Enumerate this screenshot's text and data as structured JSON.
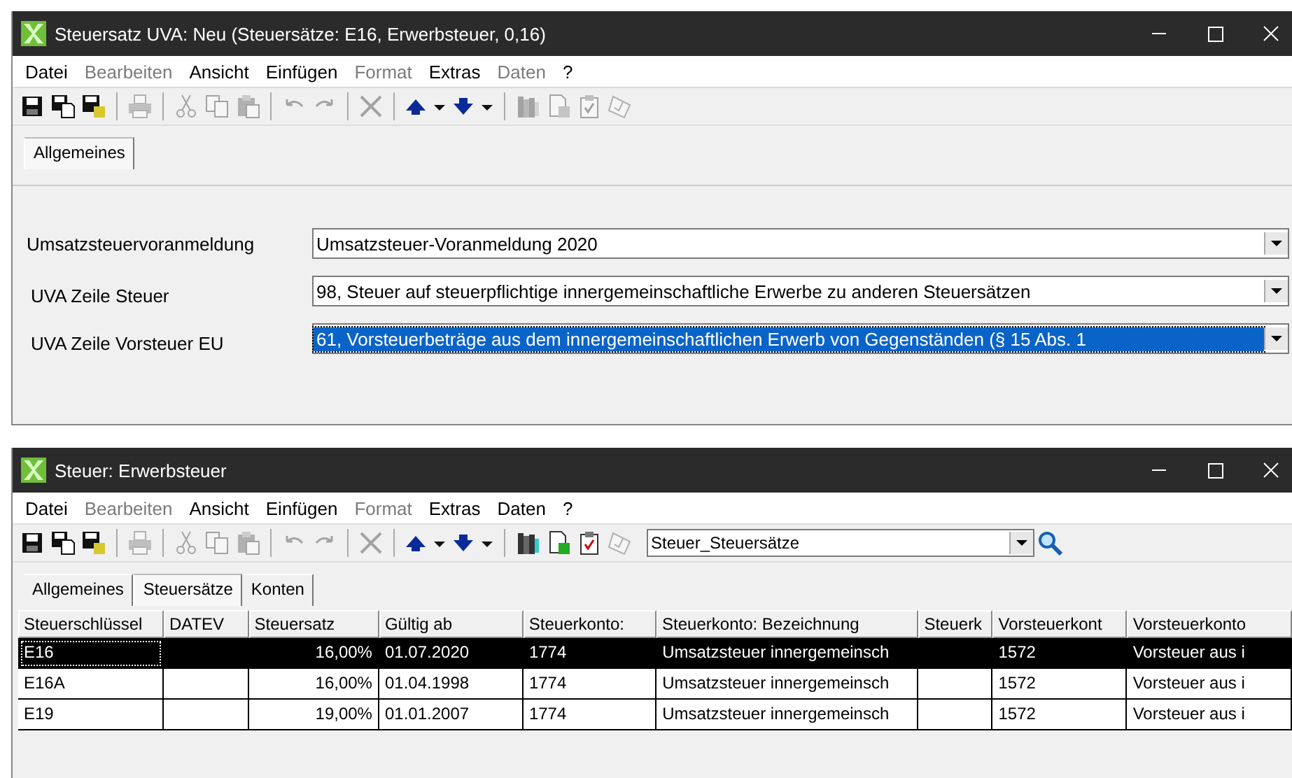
{
  "windows": [
    {
      "title": "Steuersatz UVA: Neu (Steuersätze: E16, Erwerbsteuer, 0,16)",
      "menu": [
        {
          "label": "Datei",
          "disabled": false
        },
        {
          "label": "Bearbeiten",
          "disabled": true
        },
        {
          "label": "Ansicht",
          "disabled": false
        },
        {
          "label": "Einfügen",
          "disabled": false
        },
        {
          "label": "Format",
          "disabled": true
        },
        {
          "label": "Extras",
          "disabled": false
        },
        {
          "label": "Daten",
          "disabled": true
        },
        {
          "label": "?",
          "disabled": false
        }
      ],
      "toolbar": [
        [
          {
            "kind": "save",
            "disabled": false
          },
          {
            "kind": "save-copy",
            "disabled": false
          },
          {
            "kind": "save-all",
            "disabled": false
          }
        ],
        [
          {
            "kind": "print",
            "disabled": true
          }
        ],
        [
          {
            "kind": "cut",
            "disabled": true
          },
          {
            "kind": "copy",
            "disabled": true
          },
          {
            "kind": "paste",
            "disabled": true
          }
        ],
        [
          {
            "kind": "undo",
            "disabled": true
          },
          {
            "kind": "redo",
            "disabled": true
          }
        ],
        [
          {
            "kind": "delete",
            "disabled": true
          }
        ],
        [
          {
            "kind": "up",
            "disabled": false
          },
          {
            "kind": "down",
            "disabled": false
          }
        ],
        [
          {
            "kind": "binder",
            "disabled": true
          },
          {
            "kind": "doc-add",
            "disabled": true
          },
          {
            "kind": "checklist",
            "disabled": true
          },
          {
            "kind": "stamp",
            "disabled": true
          }
        ]
      ],
      "tabs": [
        {
          "label": "Allgemeines",
          "selected": true
        }
      ],
      "form": [
        {
          "label": "Umsatzsteuervoranmeldung",
          "value": "Umsatzsteuer-Voranmeldung 2020",
          "selected": false
        },
        {
          "label": "UVA Zeile Steuer",
          "value": "98, Steuer auf steuerpflichtige innergemeinschaftliche Erwerbe zu anderen Steuersätzen",
          "selected": false
        },
        {
          "label": "UVA Zeile Vorsteuer EU",
          "value": "61, Vorsteuerbeträge aus dem innergemeinschaftlichen Erwerb von Gegenständen (§ 15 Abs. 1",
          "selected": true
        }
      ]
    },
    {
      "title": "Steuer: Erwerbsteuer",
      "menu": [
        {
          "label": "Datei",
          "disabled": false
        },
        {
          "label": "Bearbeiten",
          "disabled": true
        },
        {
          "label": "Ansicht",
          "disabled": false
        },
        {
          "label": "Einfügen",
          "disabled": false
        },
        {
          "label": "Format",
          "disabled": true
        },
        {
          "label": "Extras",
          "disabled": false
        },
        {
          "label": "Daten",
          "disabled": false
        },
        {
          "label": "?",
          "disabled": false
        }
      ],
      "toolbar": [
        [
          {
            "kind": "save",
            "disabled": false
          },
          {
            "kind": "save-copy",
            "disabled": false
          },
          {
            "kind": "save-all",
            "disabled": false
          }
        ],
        [
          {
            "kind": "print",
            "disabled": true
          }
        ],
        [
          {
            "kind": "cut",
            "disabled": true
          },
          {
            "kind": "copy",
            "disabled": true
          },
          {
            "kind": "paste",
            "disabled": true
          }
        ],
        [
          {
            "kind": "undo",
            "disabled": true
          },
          {
            "kind": "redo",
            "disabled": true
          }
        ],
        [
          {
            "kind": "delete",
            "disabled": true
          }
        ],
        [
          {
            "kind": "up",
            "disabled": false
          },
          {
            "kind": "down",
            "disabled": false
          }
        ],
        [
          {
            "kind": "binder",
            "disabled": false
          },
          {
            "kind": "doc-add",
            "disabled": false
          },
          {
            "kind": "checklist",
            "disabled": false
          },
          {
            "kind": "stamp",
            "disabled": true
          }
        ]
      ],
      "view_select": {
        "value": "Steuer_Steuersätze"
      },
      "tabs": [
        {
          "label": "Allgemeines",
          "selected": false
        },
        {
          "label": "Steuersätze",
          "selected": true
        },
        {
          "label": "Konten",
          "selected": false
        }
      ],
      "table": {
        "columns": [
          "Steuerschlüssel",
          "DATEV",
          "Steuersatz",
          "Gültig ab",
          "Steuerkonto:",
          "Steuerkonto: Bezeichnung",
          "Steuerk",
          "Vorsteuerkont",
          "Vorsteuerkonto"
        ],
        "rows": [
          {
            "selected": true,
            "cells": [
              "E16",
              "",
              "16,00%",
              "01.07.2020",
              "1774",
              "Umsatzsteuer innergemeinsch",
              "",
              "1572",
              "Vorsteuer aus i"
            ]
          },
          {
            "selected": false,
            "cells": [
              "E16A",
              "",
              "16,00%",
              "01.04.1998",
              "1774",
              "Umsatzsteuer innergemeinsch",
              "",
              "1572",
              "Vorsteuer aus i"
            ]
          },
          {
            "selected": false,
            "cells": [
              "E19",
              "",
              "19,00%",
              "01.01.2007",
              "1774",
              "Umsatzsteuer innergemeinsch",
              "",
              "1572",
              "Vorsteuer aus i"
            ]
          }
        ]
      }
    }
  ]
}
